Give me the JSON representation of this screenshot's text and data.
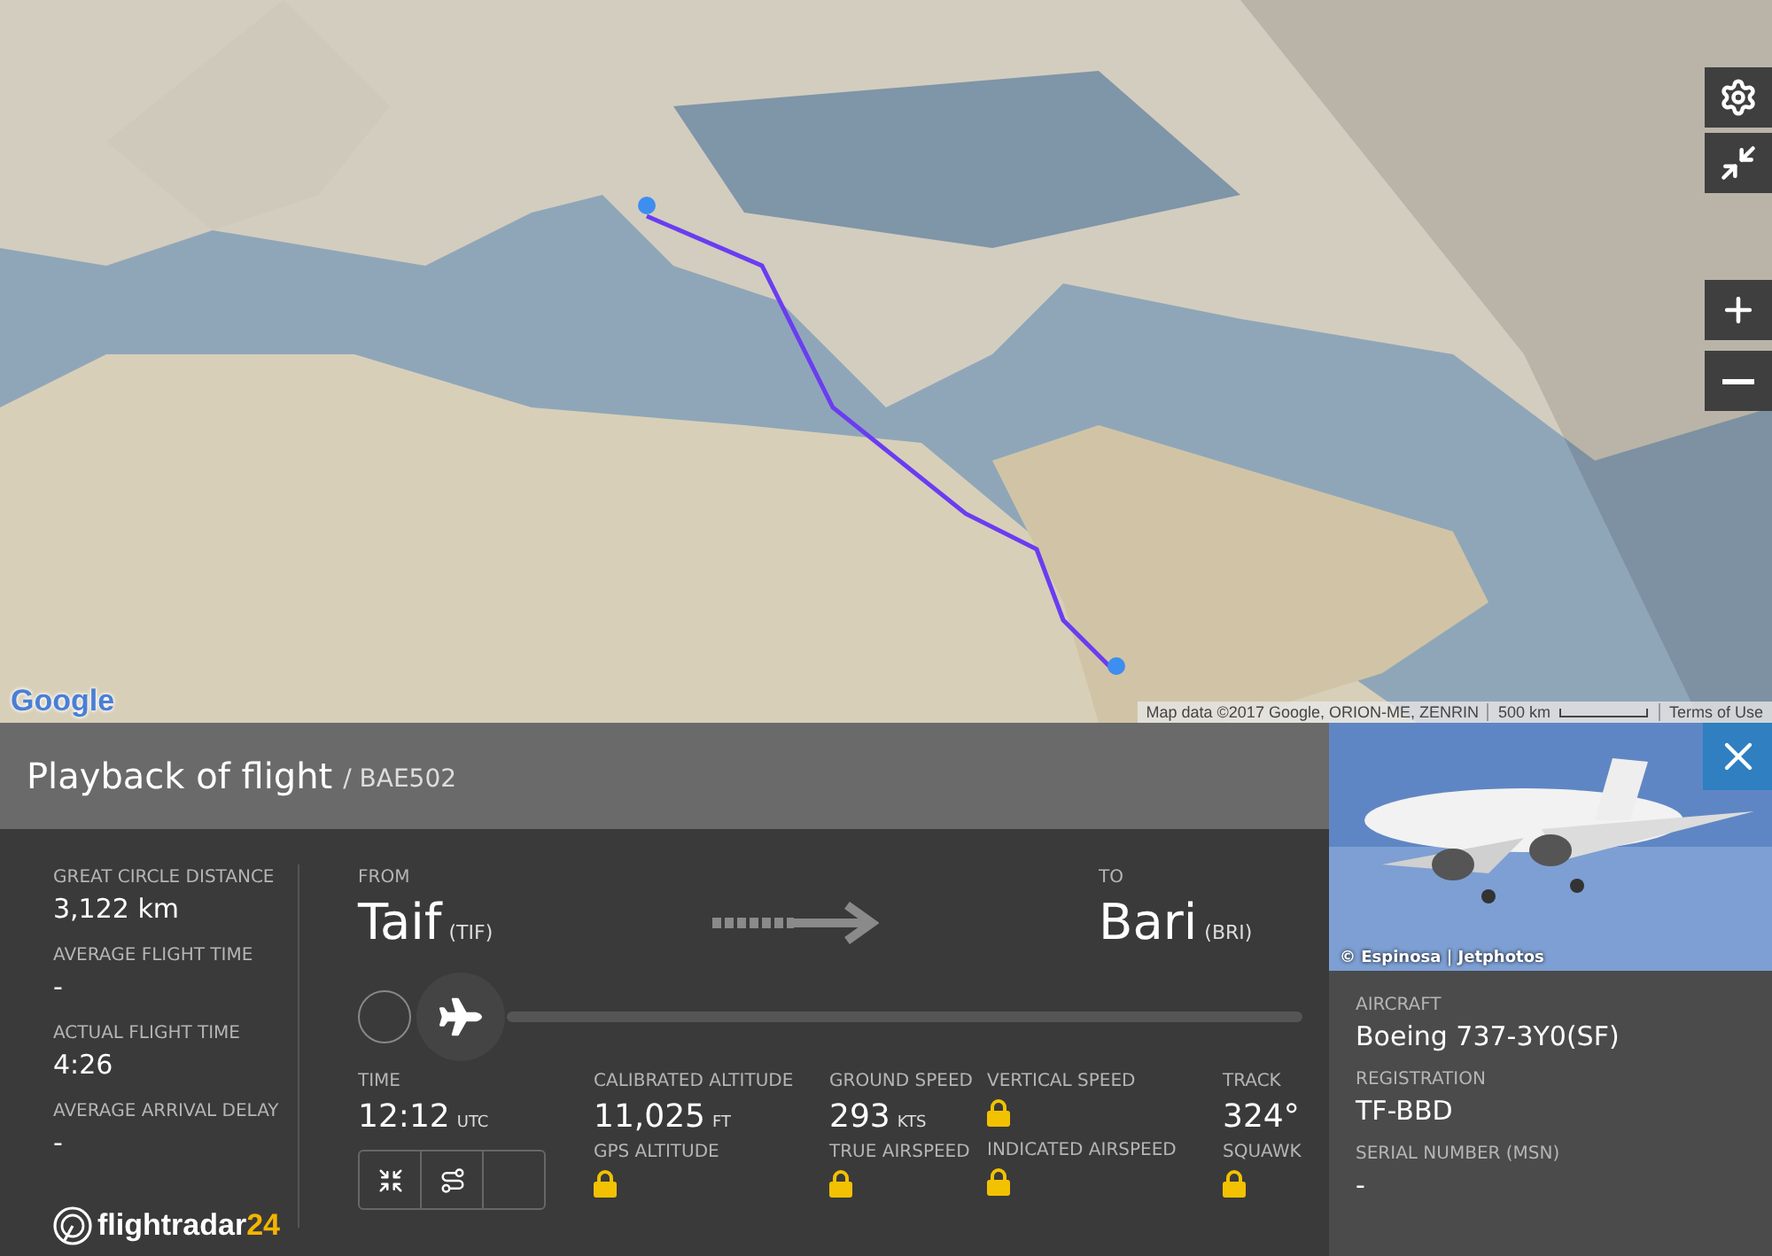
{
  "map": {
    "logo": "Google",
    "attribution": "Map data ©2017 Google, ORION-ME, ZENRIN",
    "scale": "500 km",
    "terms": "Terms of Use"
  },
  "map_controls": [
    {
      "kind": "settings"
    },
    {
      "kind": "fullscreen"
    },
    {
      "kind": "zoom_in"
    },
    {
      "kind": "zoom_out"
    }
  ],
  "panel": {
    "title": "Playback of flight",
    "flight": "/ BAE502"
  },
  "summary": [
    {
      "label": "GREAT CIRCLE DISTANCE",
      "value": "3,122 km"
    },
    {
      "label": "AVERAGE FLIGHT TIME",
      "value": "-"
    },
    {
      "label": "ACTUAL FLIGHT TIME",
      "value": "4:26"
    },
    {
      "label": "AVERAGE ARRIVAL DELAY",
      "value": "-"
    }
  ],
  "brand": {
    "name": "flightradar",
    "suffix": "24"
  },
  "route": {
    "from_label": "FROM",
    "from_city": "Taif",
    "from_code": "(TIF)",
    "to_label": "TO",
    "to_city": "Bari",
    "to_code": "(BRI)"
  },
  "playback": {
    "level": 0
  },
  "time": {
    "label": "TIME",
    "value": "12:12",
    "unit": "UTC"
  },
  "view_buttons": [
    {
      "kind": "compress"
    },
    {
      "kind": "route"
    },
    {
      "kind": "blank"
    }
  ],
  "metrics": [
    [
      {
        "kind": "value",
        "label": "CALIBRATED ALTITUDE",
        "value": "11,025",
        "unit": "FT"
      },
      {
        "kind": "locked",
        "label": "GPS ALTITUDE"
      }
    ],
    [
      {
        "kind": "value",
        "label": "GROUND SPEED",
        "value": "293",
        "unit": "KTS"
      },
      {
        "kind": "locked",
        "label": "TRUE AIRSPEED"
      }
    ],
    [
      {
        "kind": "locked",
        "label": "VERTICAL SPEED"
      },
      {
        "kind": "locked",
        "label": "INDICATED AIRSPEED"
      }
    ],
    [
      {
        "kind": "value",
        "label": "TRACK",
        "value": "324°"
      },
      {
        "kind": "locked",
        "label": "SQUAWK"
      }
    ]
  ],
  "aircraft": {
    "photo": {
      "kind": "picture",
      "credit": "© Espinosa | Jetphotos"
    },
    "details": [
      {
        "label": "AIRCRAFT",
        "value": "Boeing 737-3Y0(SF)"
      },
      {
        "label": "REGISTRATION",
        "value": "TF-BBD"
      },
      {
        "label": "SERIAL NUMBER (MSN)",
        "value": "-"
      }
    ]
  }
}
